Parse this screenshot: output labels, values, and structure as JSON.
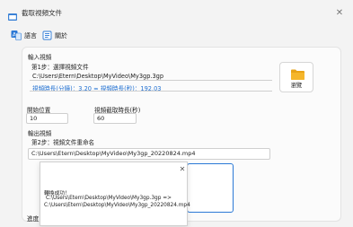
{
  "window": {
    "title": "截取視頻文件",
    "close_glyph": "✕"
  },
  "menu": {
    "language": "語言",
    "about": "關於"
  },
  "input_section": {
    "title": "輸入視頻",
    "step1": "第1步：選擇視頻文件",
    "file_path": "C:\\Users\\Etern\\Desktop\\MyVideo\\My3gp.3gp",
    "duration_info": "視頻時長(分鐘)：3.20 ≈ 視頻時長(秒)：192.03",
    "browse_label": "瀏覽"
  },
  "settings": {
    "start_label": "開始位置",
    "start_value": "10",
    "duration_label": "視頻截取時長(秒)",
    "duration_value": "60"
  },
  "output_section": {
    "title": "輸出視頻",
    "step2": "第2步：視頻文件重命名",
    "file_path": "C:\\Users\\Etern\\Desktop\\MyVideo\\My3gp_20220824.mp4"
  },
  "bottom": {
    "progress_label": "進度"
  },
  "dialog": {
    "message_title": "轉換成功！",
    "line1": "C:\\Users\\Etern\\Desktop\\MyVideo\\My3gp.3gp =>",
    "line2": "C:\\Users\\Etern\\Desktop\\MyVideo\\My3gp_20220824.mp4",
    "close_glyph": "✕"
  },
  "colors": {
    "accent": "#1f6fd1",
    "folder": "#f5b62b"
  },
  "icons": {
    "app": "app-window-icon",
    "language": "language-icon",
    "about": "info-book-icon",
    "folder": "folder-icon"
  }
}
